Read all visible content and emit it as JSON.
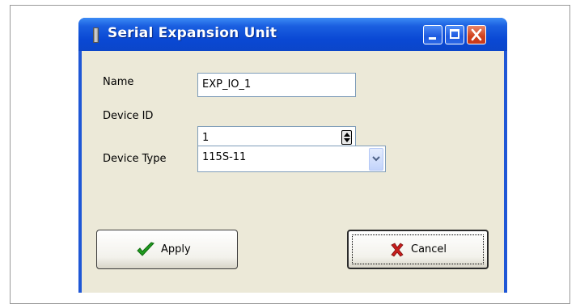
{
  "window": {
    "title": "Serial Expansion Unit",
    "controls": [
      "minimize-icon",
      "maximize-icon",
      "close-icon"
    ]
  },
  "form": {
    "name_label": "Name",
    "name_value": "EXP_IO_1",
    "device_id_label": "Device ID",
    "device_id_value": "1",
    "device_type_label": "Device Type",
    "device_type_value": "115S-11"
  },
  "buttons": {
    "apply_label": "Apply",
    "apply_icon": "checkmark-icon",
    "cancel_label": "Cancel",
    "cancel_icon": "x-icon"
  },
  "colors": {
    "titlebar": "#0a48d4",
    "client_bg": "#ece9d8",
    "apply_check": "#1f9b1f",
    "cancel_x": "#c81e1e",
    "close_button": "#d0401c"
  }
}
